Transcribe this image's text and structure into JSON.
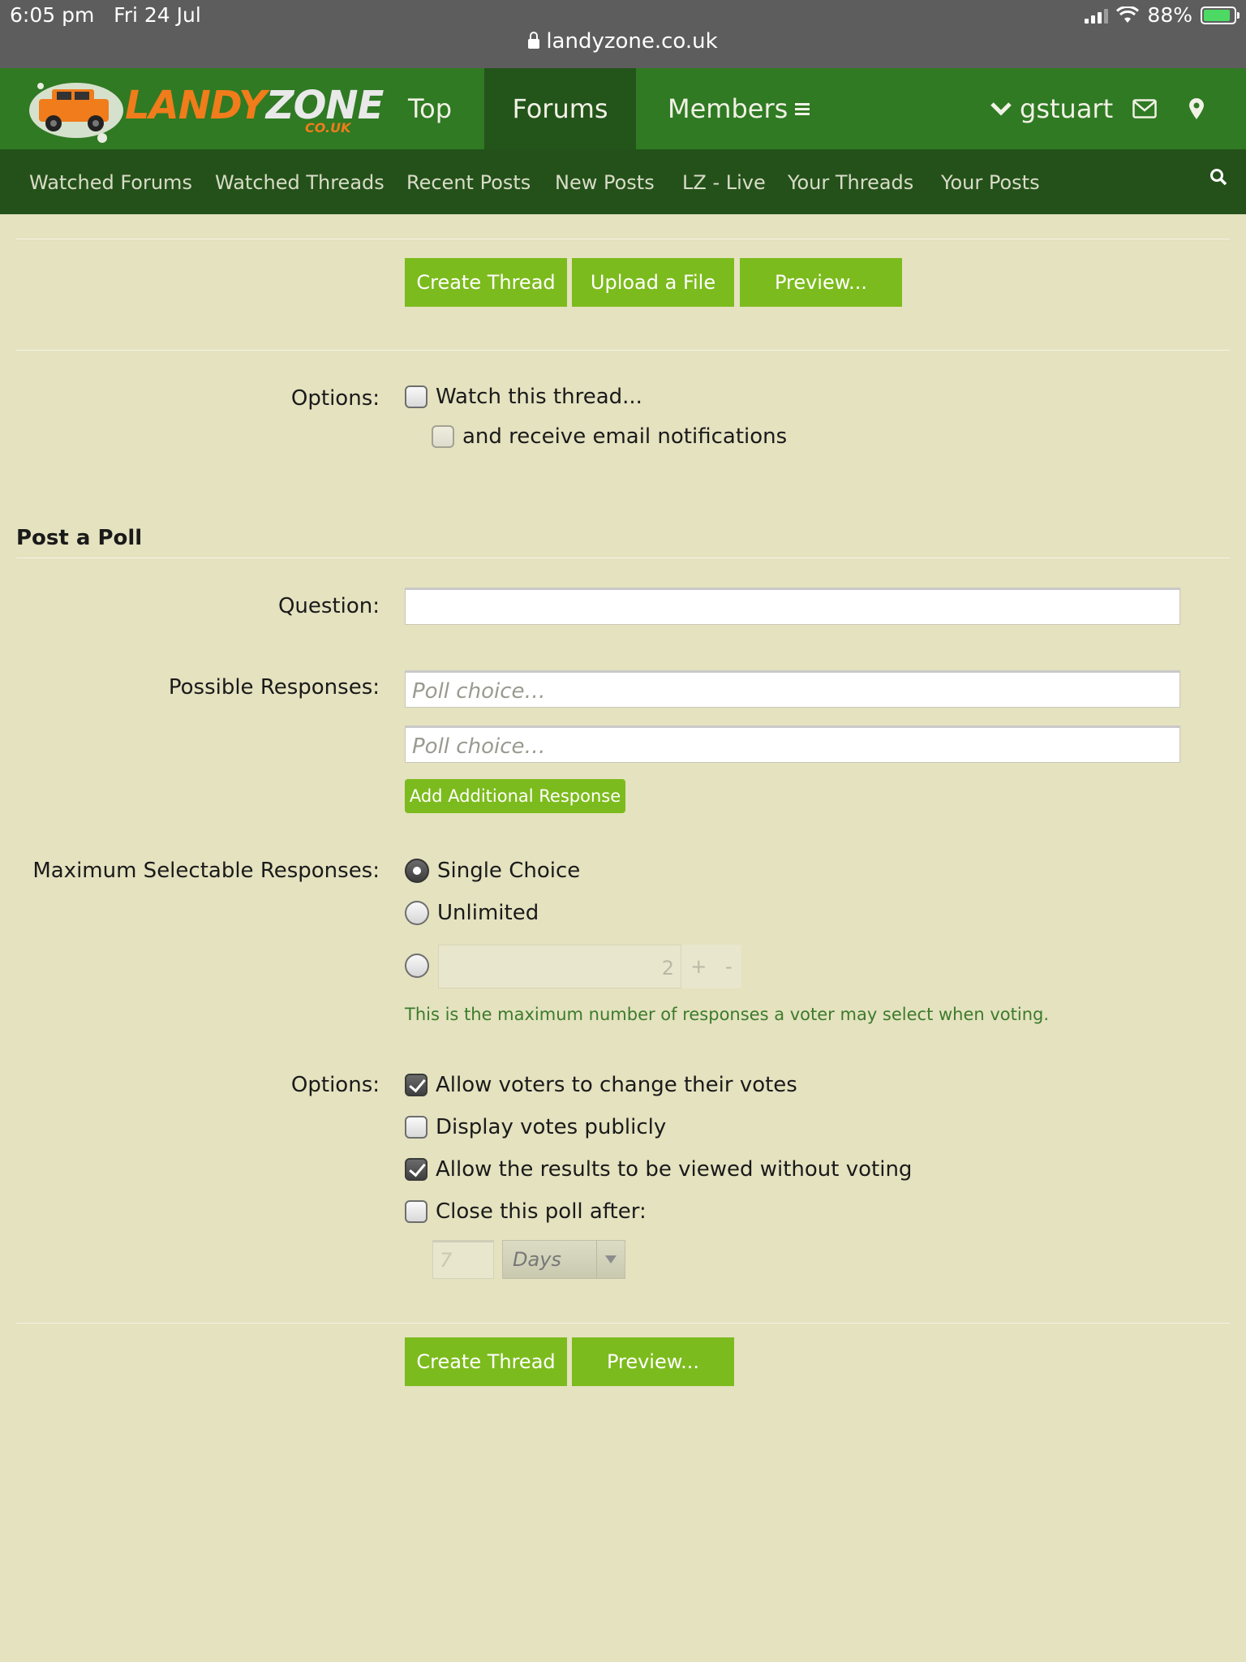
{
  "status_bar": {
    "time": "6:05 pm",
    "date": "Fri 24 Jul",
    "battery": "88%",
    "url": "landyzone.co.uk"
  },
  "logo": {
    "part1": "LANDY",
    "part2": "ZONE",
    "sub": "CO.UK"
  },
  "nav": {
    "tabs": [
      {
        "label": "Top"
      },
      {
        "label": "Forums"
      },
      {
        "label": "Members"
      }
    ],
    "active_tab": "Forums",
    "user": "gstuart"
  },
  "subnav": {
    "items": [
      {
        "label": "Watched Forums"
      },
      {
        "label": "Watched Threads"
      },
      {
        "label": "Recent Posts"
      },
      {
        "label": "New Posts"
      },
      {
        "label": "LZ - Live"
      },
      {
        "label": "Your Threads"
      },
      {
        "label": "Your Posts"
      }
    ]
  },
  "top_buttons": {
    "create_thread": "Create Thread",
    "upload_file": "Upload a File",
    "preview": "Preview..."
  },
  "thread_options": {
    "label": "Options:",
    "watch": {
      "label": "Watch this thread...",
      "checked": false
    },
    "email": {
      "label": "and receive email notifications",
      "checked": false
    }
  },
  "poll": {
    "title": "Post a Poll",
    "question_label": "Question:",
    "question_value": "",
    "responses_label": "Possible Responses:",
    "choice_placeholder": "Poll choice…",
    "add_response": "Add Additional Response",
    "max_label": "Maximum Selectable Responses:",
    "single_choice": "Single Choice",
    "unlimited": "Unlimited",
    "custom_value": "2",
    "plus": "+",
    "minus": "-",
    "max_hint": "This is the maximum number of responses a voter may select when voting.",
    "selected_max": "Single Choice",
    "options_label": "Options:",
    "options": [
      {
        "label": "Allow voters to change their votes",
        "checked": true
      },
      {
        "label": "Display votes publicly",
        "checked": false
      },
      {
        "label": "Allow the results to be viewed without voting",
        "checked": true
      },
      {
        "label": "Close this poll after:",
        "checked": false
      }
    ],
    "close_after_value": "7",
    "close_after_unit": "Days"
  },
  "bottom_buttons": {
    "create_thread": "Create Thread",
    "preview": "Preview..."
  },
  "colors": {
    "page_bg": "#e4e2bf",
    "main_nav": "#2f7a23",
    "sub_nav": "#24511a",
    "button": "#7cbb1d",
    "logo_orange": "#f07c1b"
  }
}
